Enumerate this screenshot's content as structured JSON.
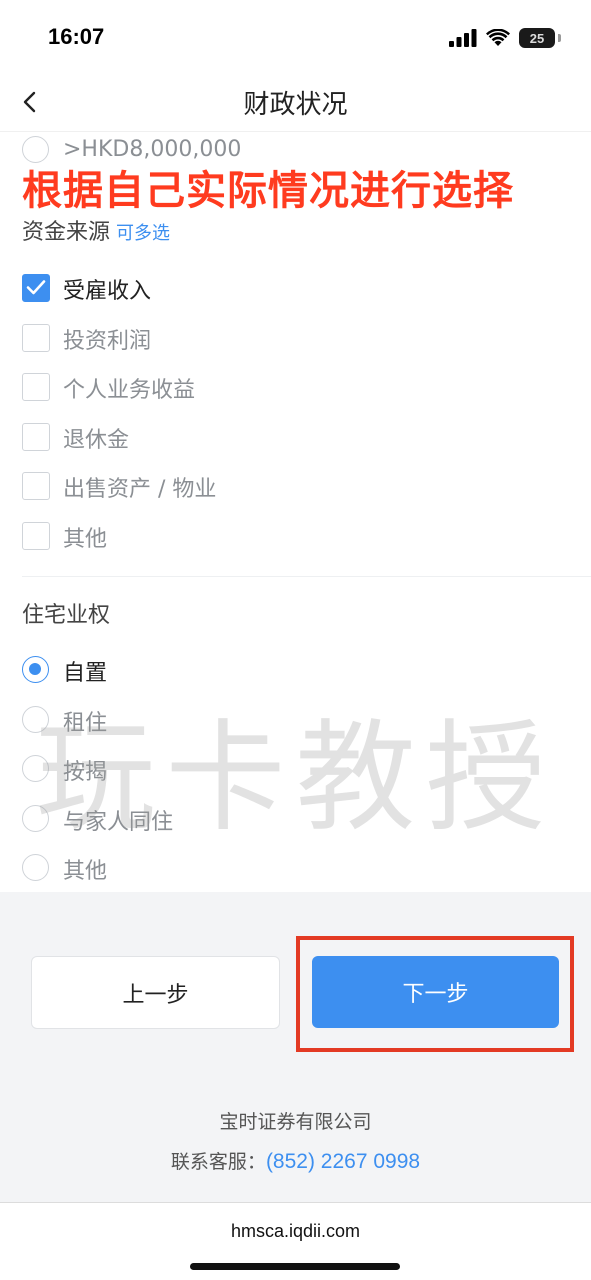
{
  "status_bar": {
    "time": "16:07",
    "battery_level": 25,
    "battery_text": "25"
  },
  "nav": {
    "title": "财政状况",
    "back_icon": "chevron-left-icon"
  },
  "net_worth_partial_option": {
    "label": ">HKD8,000,000",
    "selected": false
  },
  "overlay_banner": "根据自己实际情况进行选择",
  "fund_source": {
    "title": "资金来源",
    "hint": "可多选",
    "options": [
      {
        "label": "受雇收入",
        "checked": true
      },
      {
        "label": "投资利润",
        "checked": false
      },
      {
        "label": "个人业务收益",
        "checked": false
      },
      {
        "label": "退休金",
        "checked": false
      },
      {
        "label": "出售资产 / 物业",
        "checked": false
      },
      {
        "label": "其他",
        "checked": false
      }
    ]
  },
  "residence": {
    "title": "住宅业权",
    "options": [
      {
        "label": "自置",
        "selected": true
      },
      {
        "label": "租住",
        "selected": false
      },
      {
        "label": "按揭",
        "selected": false
      },
      {
        "label": "与家人同住",
        "selected": false
      },
      {
        "label": "其他",
        "selected": false
      }
    ]
  },
  "watermark": "玩卡教授",
  "footer": {
    "prev_label": "上一步",
    "next_label": "下一步",
    "company": "宝时证券有限公司",
    "contact_label": "联系客服：",
    "contact_phone": "(852) 2267 0998"
  },
  "browser": {
    "url": "hmsca.iqdii.com"
  },
  "colors": {
    "accent": "#3d8ff0",
    "banner": "#ff3b1f",
    "highlight": "#e33a24"
  }
}
